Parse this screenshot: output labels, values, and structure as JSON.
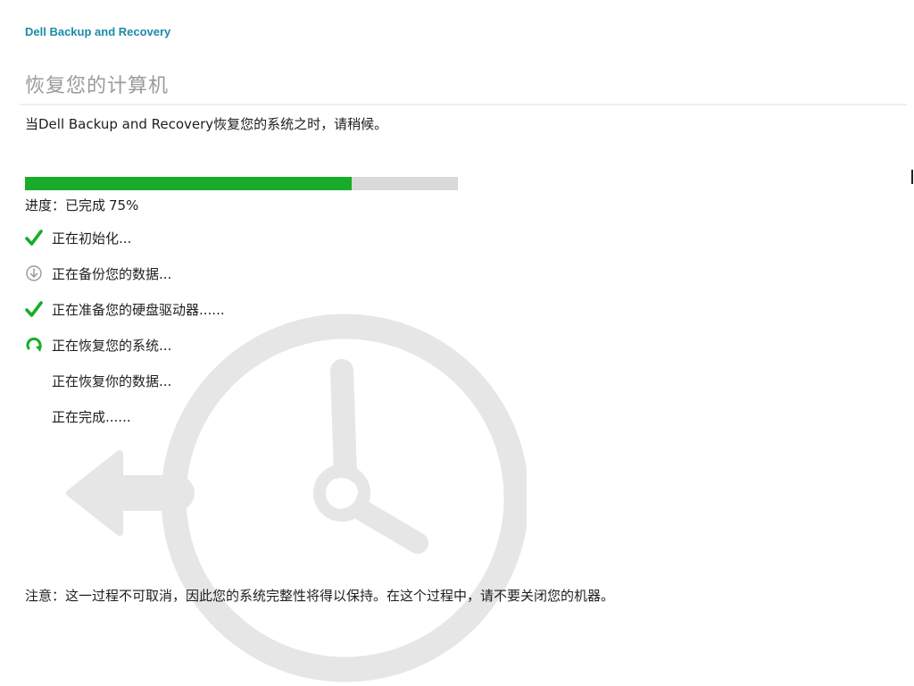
{
  "app": {
    "brand": "Dell Backup and Recovery"
  },
  "header": {
    "title": "恢复您的计算机",
    "subtitle": "当Dell Backup and Recovery恢复您的系统之时，请稍候。"
  },
  "progress": {
    "label": "进度：已完成",
    "percent_text": "75%",
    "value": 0.755,
    "fill_color": "#19ac2a",
    "track_color": "#d9d9d9"
  },
  "steps": [
    {
      "label": "正在初始化...",
      "status": "done",
      "icon": "check-icon"
    },
    {
      "label": "正在备份您的数据...",
      "status": "skipped",
      "icon": "download-circle-icon"
    },
    {
      "label": "正在准备您的硬盘驱动器......",
      "status": "done",
      "icon": "check-icon"
    },
    {
      "label": "正在恢复您的系统...",
      "status": "in-progress",
      "icon": "refresh-icon"
    },
    {
      "label": "正在恢复你的数据...",
      "status": "pending",
      "icon": ""
    },
    {
      "label": "正在完成......",
      "status": "pending",
      "icon": ""
    }
  ],
  "note": "注意：这一过程不可取消，因此您的系统完整性将得以保持。在这个过程中，请不要关闭您的机器。",
  "colors": {
    "brand": "#1a8ca8",
    "accent": "#19ac2a",
    "watermark": "#e6e6e6"
  }
}
